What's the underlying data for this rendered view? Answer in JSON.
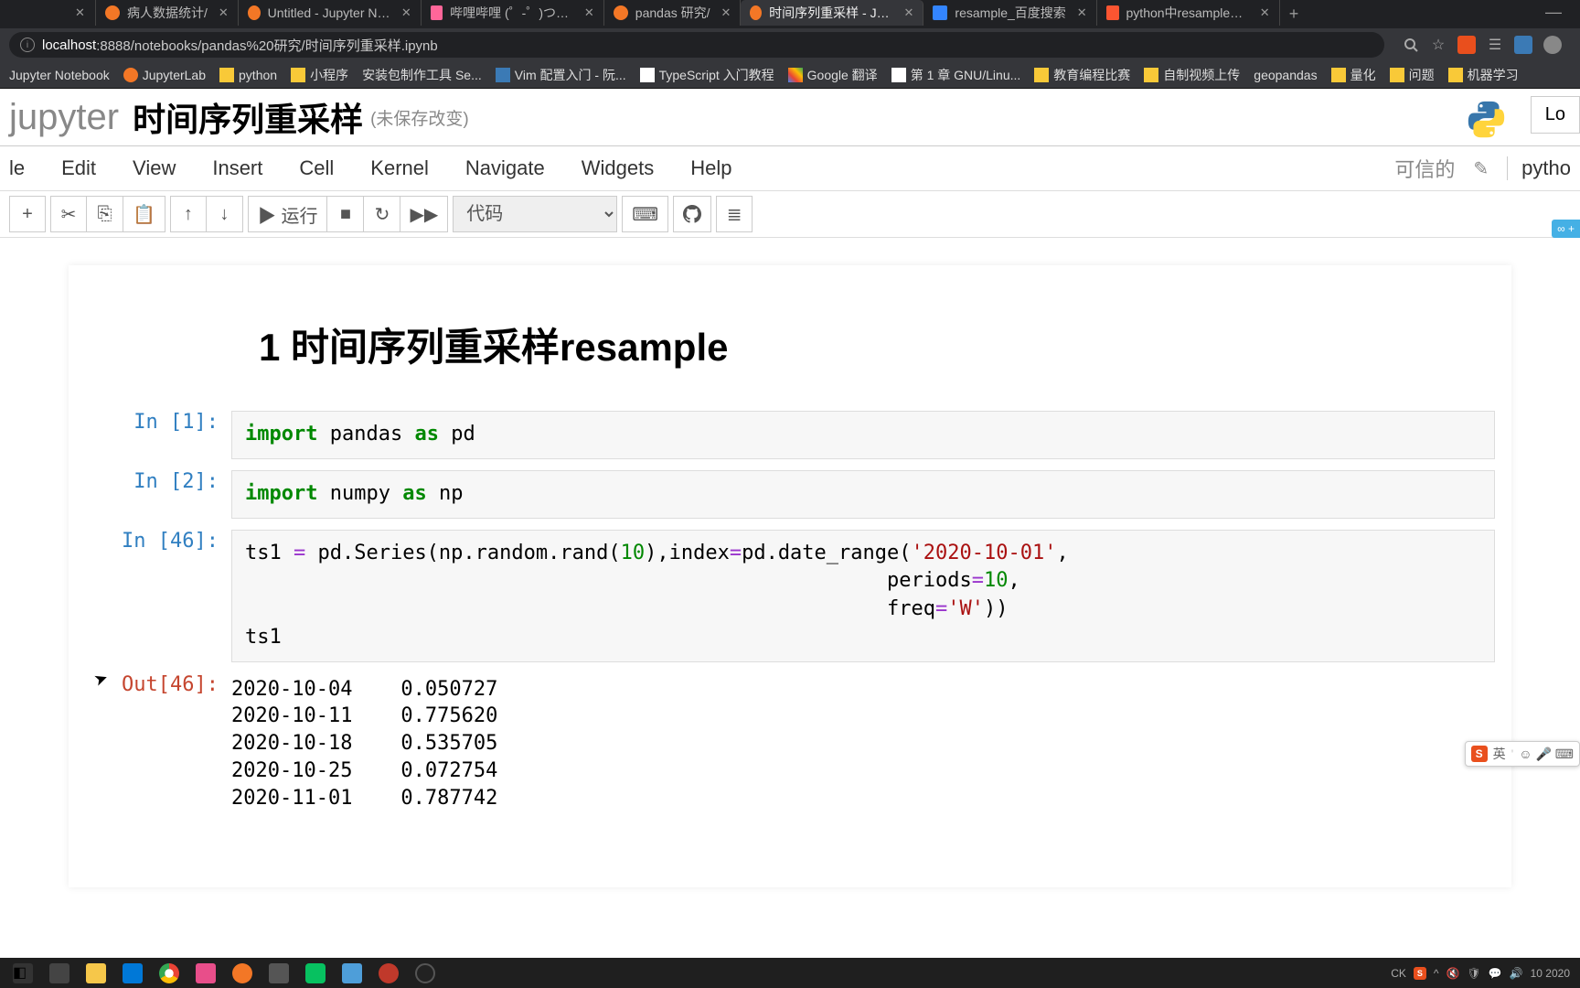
{
  "browser": {
    "tabs": [
      {
        "title": "",
        "icon": "none"
      },
      {
        "title": "病人数据统计/",
        "icon": "jup"
      },
      {
        "title": "Untitled - Jupyter Notebo",
        "icon": "jup"
      },
      {
        "title": "哔哩哔哩 (゜-゜)つロ 干杯",
        "icon": "bili"
      },
      {
        "title": "pandas 研究/",
        "icon": "jup"
      },
      {
        "title": "时间序列重采样 - Jupyter N",
        "icon": "jup",
        "active": true
      },
      {
        "title": "resample_百度搜索",
        "icon": "baidu"
      },
      {
        "title": "python中resample函数实",
        "icon": "csdn"
      }
    ],
    "url_host": "localhost",
    "url_path": ":8888/notebooks/pandas%20研究/时间序列重采样.ipynb"
  },
  "bookmarks": [
    {
      "label": "Jupyter Notebook",
      "icon": ""
    },
    {
      "label": "JupyterLab",
      "icon": "jup"
    },
    {
      "label": "python",
      "icon": "yellow"
    },
    {
      "label": "小程序",
      "icon": "yellow"
    },
    {
      "label": "安装包制作工具 Se...",
      "icon": ""
    },
    {
      "label": "Vim 配置入门 - 阮...",
      "icon": "blue"
    },
    {
      "label": "TypeScript 入门教程",
      "icon": "white"
    },
    {
      "label": "Google 翻译",
      "icon": "google"
    },
    {
      "label": "第 1 章 GNU/Linu...",
      "icon": "white"
    },
    {
      "label": "教育编程比赛",
      "icon": "yellow"
    },
    {
      "label": "自制视频上传",
      "icon": "yellow"
    },
    {
      "label": "geopandas",
      "icon": ""
    },
    {
      "label": "量化",
      "icon": "yellow"
    },
    {
      "label": "问题",
      "icon": "yellow"
    },
    {
      "label": "机器学习",
      "icon": "yellow"
    }
  ],
  "notebook": {
    "logo": "jupyter",
    "title": "时间序列重采样",
    "status": "(未保存改变)",
    "logout": "Lo",
    "menu": [
      "le",
      "Edit",
      "View",
      "Insert",
      "Cell",
      "Kernel",
      "Navigate",
      "Widgets",
      "Help"
    ],
    "trusted": "可信的",
    "kernel": "pytho",
    "toolbar": {
      "add": "+",
      "cut": "✂",
      "copy": "⎘",
      "paste": "📋",
      "up": "↑",
      "down": "↓",
      "run": "▶ 运行",
      "stop": "■",
      "restart": "↻",
      "ff": "▶▶",
      "select": "代码",
      "keyboard": "⌨",
      "github": "⊙",
      "list": "≣"
    },
    "heading": "1  时间序列重采样resample",
    "cells": {
      "in1": {
        "prompt": "In [1]:",
        "code_kw": "import",
        "code_mid": " pandas ",
        "code_as": "as",
        "code_end": " pd"
      },
      "in2": {
        "prompt": "In [2]:",
        "code_kw": "import",
        "code_mid": " numpy ",
        "code_as": "as",
        "code_end": " np"
      },
      "in46": {
        "prompt": "In [46]:"
      },
      "out46": {
        "prompt": "Out[46]:",
        "lines": [
          "2020-10-04    0.050727",
          "2020-10-11    0.775620",
          "2020-10-18    0.535705",
          "2020-10-25    0.072754",
          "2020-11-01    0.787742"
        ]
      }
    }
  },
  "ime": {
    "lang": "英",
    "icons": "☺ 🎤 ⌨"
  },
  "taskbar_time": "10\n2020"
}
